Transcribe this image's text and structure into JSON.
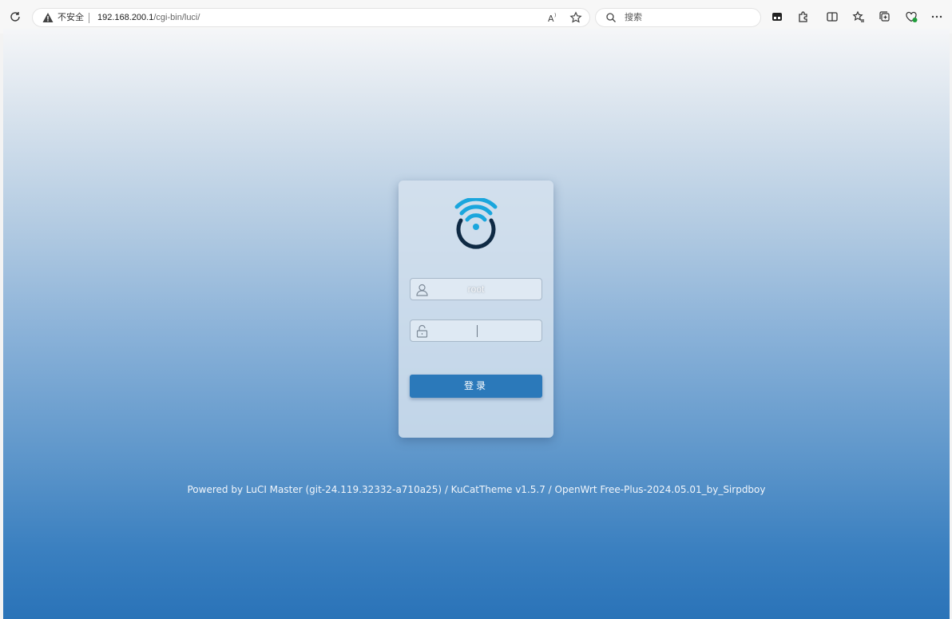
{
  "browser": {
    "security_label": "不安全",
    "url_host": "192.168.200.1",
    "url_path": "/cgi-bin/luci/",
    "search_placeholder": "搜索",
    "icons": [
      "refresh-icon",
      "warning-icon",
      "read-aloud-icon",
      "favorite-star-icon",
      "search-icon",
      "extensions-icon",
      "puzzle-icon",
      "split-screen-icon",
      "favorites-icon",
      "collections-icon",
      "performance-icon",
      "more-icon"
    ]
  },
  "login": {
    "username_value": "root",
    "password_value": "",
    "submit_label": "登录"
  },
  "footer": {
    "text": "Powered by LuCI Master (git-24.119.32332-a710a25) / KuCatTheme v1.5.7 / OpenWrt Free-Plus-2024.05.01_by_Sirpdboy"
  },
  "colors": {
    "accent": "#2b79ba",
    "logo_cyan": "#1aa6dd",
    "logo_navy": "#0f2a44"
  }
}
